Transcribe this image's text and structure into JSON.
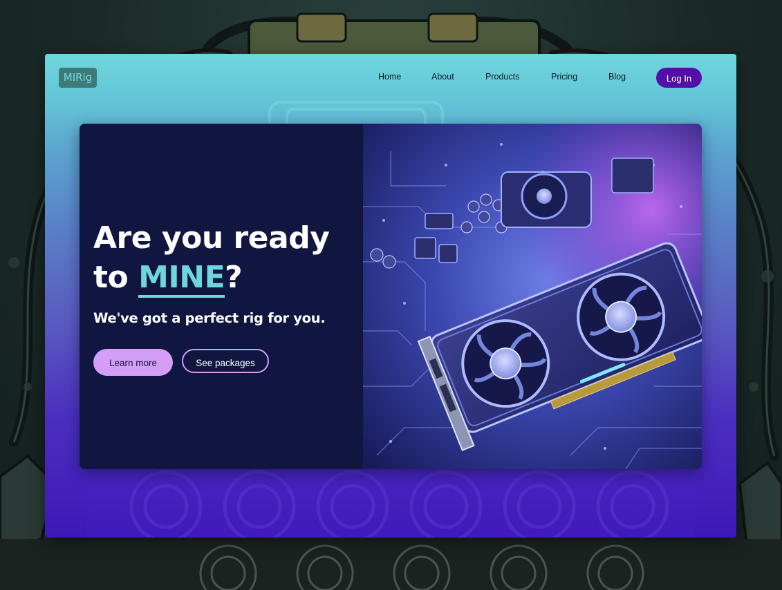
{
  "brand": {
    "logo": "MIRig"
  },
  "nav": {
    "links": [
      "Home",
      "About",
      "Products",
      "Pricing",
      "Blog"
    ],
    "login_label": "Log In"
  },
  "hero": {
    "headline_part1": "Are you ready",
    "headline_part2": "to ",
    "headline_highlight": "MINE",
    "headline_end": "?",
    "subheadline": "We've got a perfect rig for you.",
    "primary_button": "Learn more",
    "secondary_button": "See packages",
    "image_icon": "gpu-graphics-card-illustration"
  },
  "colors": {
    "accent_cyan": "#6fd6dc",
    "accent_violet": "#d49ef7",
    "login_purple": "#5210a8",
    "hero_panel": "#101640"
  }
}
